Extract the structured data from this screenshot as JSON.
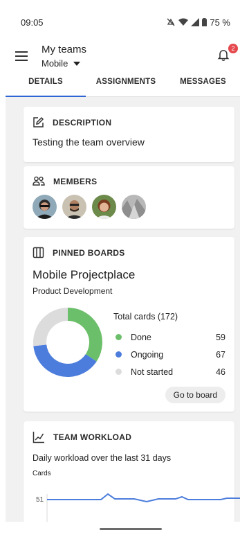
{
  "status_bar": {
    "time": "09:05",
    "battery": "75 %"
  },
  "header": {
    "title": "My teams",
    "team": "Mobile",
    "notification_count": "2"
  },
  "tabs": [
    {
      "label": "DETAILS"
    },
    {
      "label": "ASSIGNMENTS"
    },
    {
      "label": "MESSAGES"
    }
  ],
  "description": {
    "heading": "DESCRIPTION",
    "text": "Testing the team overview"
  },
  "members": {
    "heading": "MEMBERS",
    "count": 4
  },
  "pinned_boards": {
    "heading": "PINNED BOARDS",
    "board_name": "Mobile Projectplace",
    "board_subtitle": "Product Development",
    "total_label": "Total cards (172)",
    "items": [
      {
        "label": "Done",
        "value": "59",
        "color": "#6cbf6a"
      },
      {
        "label": "Ongoing",
        "value": "67",
        "color": "#4c7ddc"
      },
      {
        "label": "Not started",
        "value": "46",
        "color": "#dcdcdc"
      }
    ],
    "button_label": "Go to board"
  },
  "team_workload": {
    "heading": "TEAM WORKLOAD",
    "subtitle": "Daily workload over the last 31 days",
    "axis_label": "Cards",
    "tick_label": "51"
  },
  "chart_data": {
    "type": "pie",
    "title": "Total cards (172)",
    "categories": [
      "Done",
      "Ongoing",
      "Not started"
    ],
    "values": [
      59,
      67,
      46
    ]
  }
}
